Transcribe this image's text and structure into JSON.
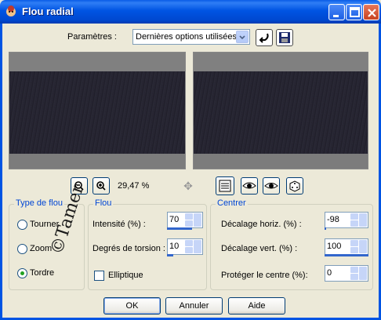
{
  "window": {
    "title": "Flou radial"
  },
  "params": {
    "label": "Paramètres :",
    "selected": "Dernières options utilisées"
  },
  "zoom": {
    "value": "29,47 %"
  },
  "blur_type": {
    "title": "Type de flou",
    "options": [
      {
        "label": "Tourner",
        "checked": false
      },
      {
        "label": "Zoom",
        "checked": false
      },
      {
        "label": "Tordre",
        "checked": true
      }
    ]
  },
  "flou": {
    "title": "Flou",
    "intensity_label": "Intensité (%) :",
    "intensity_value": "70",
    "torsion_label": "Degrés de torsion :",
    "torsion_value": "10",
    "elliptic_label": "Elliptique"
  },
  "centre": {
    "title": "Centrer",
    "h_label": "Décalage horiz. (%) :",
    "h_value": "-98",
    "v_label": "Décalage vert. (%) :",
    "v_value": "100",
    "protect_label": "Protéger le centre (%):",
    "protect_value": "0"
  },
  "watermark": "©Tamer",
  "buttons": {
    "ok": "OK",
    "cancel": "Annuler",
    "help": "Aide"
  }
}
